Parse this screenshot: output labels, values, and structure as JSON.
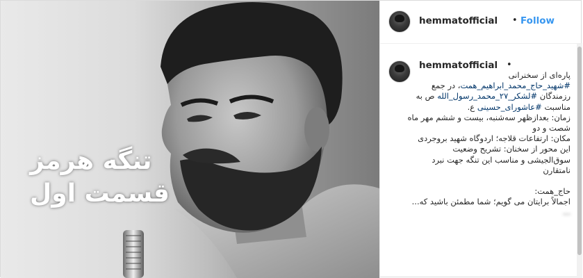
{
  "post": {
    "image": {
      "overlay_line1": "تنگه هرمز",
      "overlay_line2": "قسمت اول"
    },
    "header": {
      "username": "hemmatofficial",
      "separator": "•",
      "follow_label": "Follow"
    },
    "comment": {
      "username": "hemmatofficial",
      "separator": "•",
      "lines": [
        {
          "text": "پاره‌ای از سخنرانی",
          "style": "plain"
        },
        {
          "text": "#شهید_حاج_محمد_ابراهیم_همت، در جمع",
          "style": "mixed"
        },
        {
          "text": "رزمندگان #لشکر_۲۷_محمد_رسول_الله ص به",
          "style": "mixed"
        },
        {
          "text": "مناسبت #عاشورای_حسینی ع.",
          "style": "mixed"
        },
        {
          "text": "زمان: بعدازظهر سه‌شنبه، بیست و ششم مهر ماه",
          "style": "plain"
        },
        {
          "text": "شصت و دو",
          "style": "plain"
        },
        {
          "text": "مکان: ارتفاعات قلاجه؛ اردوگاه شهید بروجردی",
          "style": "plain"
        },
        {
          "text": "این محور از سخنان: تشریح وضعیت",
          "style": "plain"
        },
        {
          "text": "سوق‌الجیشی و مناسب این تنگه جهت نبرد",
          "style": "plain"
        },
        {
          "text": "نامتقارن",
          "style": "plain"
        },
        {
          "text": "",
          "style": "gap"
        },
        {
          "text": "حاج_همت:",
          "style": "plain"
        },
        {
          "text": "اجمالاً برایتان می گویم؛ شما مطمئن باشید که...",
          "style": "plain"
        },
        {
          "text": "...",
          "style": "blur"
        }
      ]
    }
  },
  "colors": {
    "link": "#3897f0",
    "hashtag": "#003569",
    "text": "#262626"
  }
}
